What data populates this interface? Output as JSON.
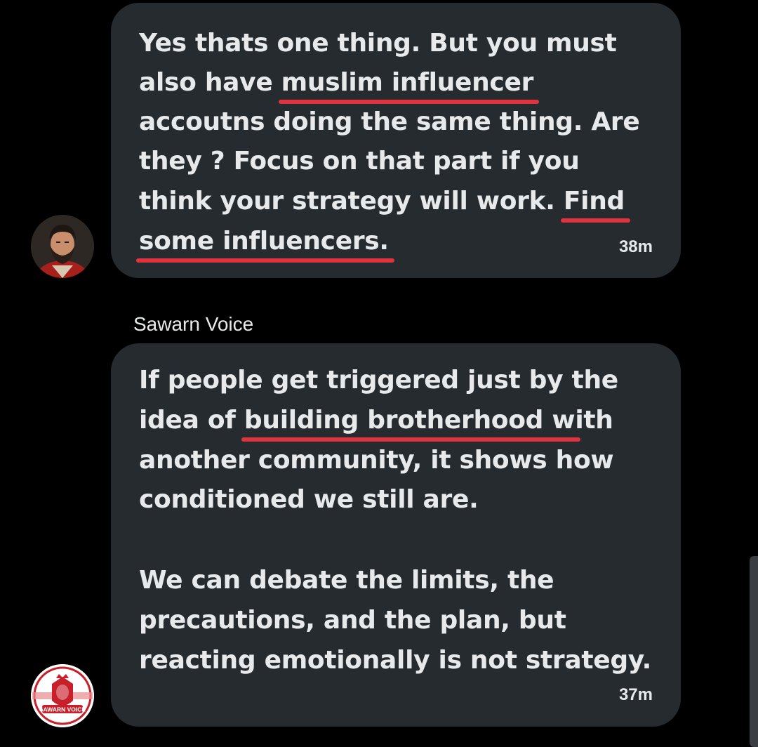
{
  "messages": [
    {
      "lines": [
        [
          "Yes thats one thing. But you must"
        ],
        [
          "also have ",
          {
            "hl": "muslim influencer"
          }
        ],
        [
          "accoutns doing the same thing. Are"
        ],
        [
          "they ? Focus on that part if you"
        ],
        [
          "think your strategy will work. ",
          {
            "hl": "Find"
          }
        ],
        [
          {
            "hl": "some influencers."
          }
        ]
      ],
      "time": "38m"
    },
    {
      "sender": "Sawarn Voice",
      "lines": [
        [
          "If people get triggered just by the"
        ],
        [
          "idea of ",
          {
            "hl": "building brotherhood w"
          },
          "ith"
        ],
        [
          "another community, it shows how"
        ],
        [
          "conditioned we still are."
        ],
        [
          ""
        ],
        [
          "We can debate the limits, the"
        ],
        [
          "precautions, and the plan, but"
        ],
        [
          "reacting emotionally is not strategy."
        ]
      ],
      "time": "37m"
    }
  ],
  "avatars": {
    "first": {
      "icon": "bearded-man-portrait"
    },
    "second": {
      "icon": "sawarn-voice-lion-logo",
      "logo_text": "SAWARN VOICE"
    }
  },
  "colors": {
    "background": "#000000",
    "bubble": "#262b30",
    "text": "#e7e9ea",
    "highlight_underline": "#e2323e"
  }
}
